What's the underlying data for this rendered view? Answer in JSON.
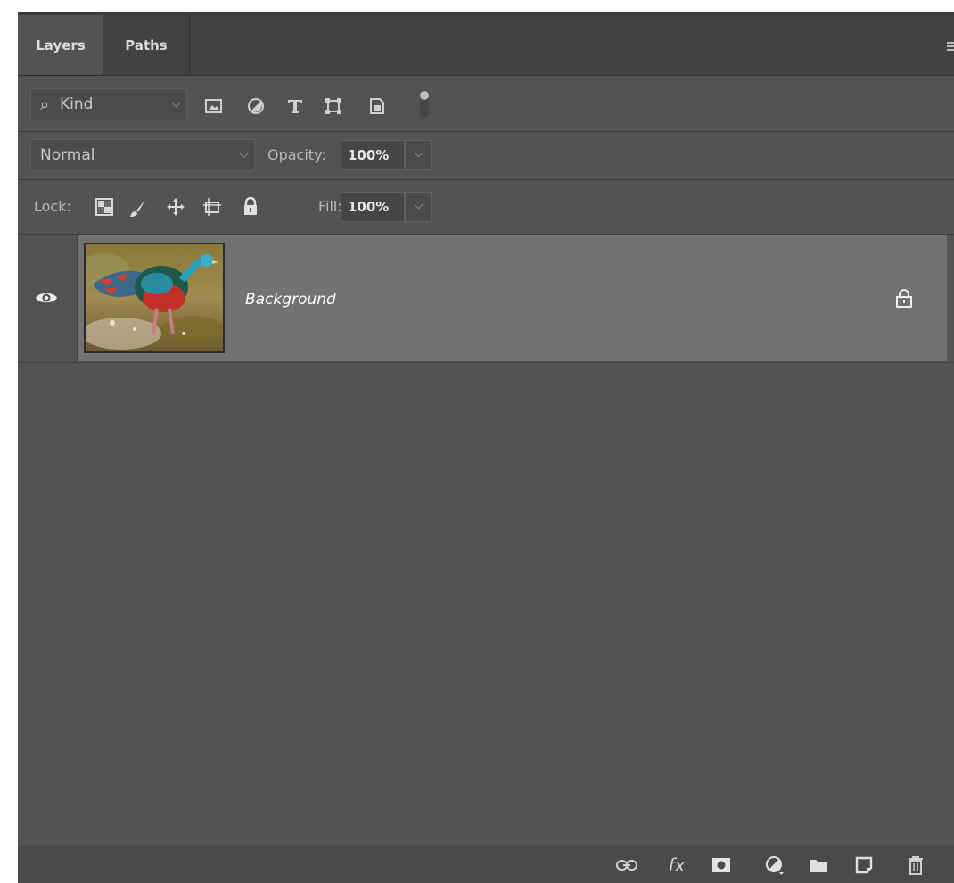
{
  "tabs": [
    {
      "label": "Layers",
      "active": true
    },
    {
      "label": "Paths",
      "active": false
    }
  ],
  "filter": {
    "kind_label": "Kind",
    "icons": [
      "image-filter-icon",
      "adjustment-filter-icon",
      "type-filter-icon",
      "shape-filter-icon",
      "smart-object-filter-icon",
      "filter-toggle-icon"
    ]
  },
  "blend": {
    "mode": "Normal",
    "opacity_label": "Opacity:",
    "opacity_value": "100%"
  },
  "lock": {
    "label": "Lock:",
    "icons": [
      "lock-transparent-pixels-icon",
      "lock-image-pixels-icon",
      "lock-position-icon",
      "lock-artboard-icon",
      "lock-all-icon"
    ],
    "fill_label": "Fill:",
    "fill_value": "100%"
  },
  "layers": [
    {
      "name": "Background",
      "visible": true,
      "locked": true,
      "selected": true
    }
  ],
  "footer_icons": [
    "link-layers-icon",
    "fx-icon",
    "layer-mask-icon",
    "adjustment-layer-icon",
    "group-folder-icon",
    "new-layer-icon",
    "trash-icon"
  ],
  "fx_text": "fx",
  "colors": {
    "panel": "#535353",
    "selected_row": "#727272",
    "tabbar": "#424242"
  }
}
